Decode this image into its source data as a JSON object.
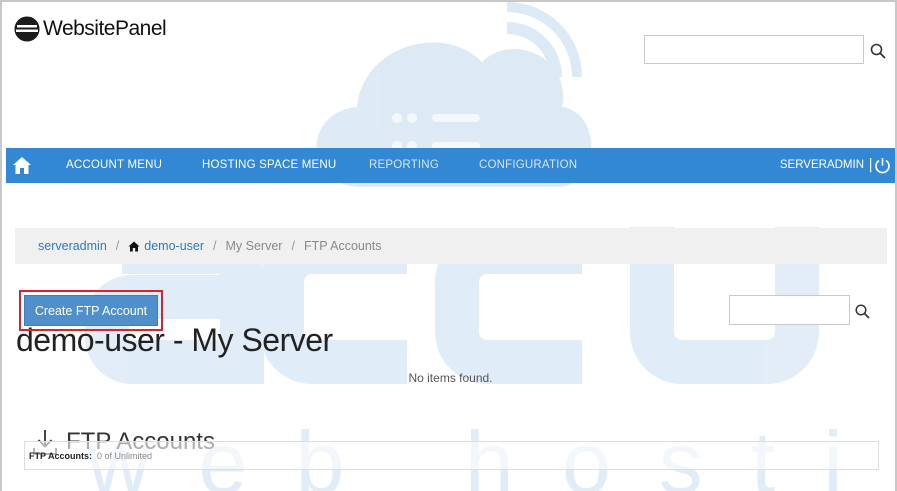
{
  "app": {
    "logo_text": "WebsitePanel"
  },
  "header": {
    "search_placeholder": ""
  },
  "nav": {
    "items": [
      {
        "label": "ACCOUNT MENU"
      },
      {
        "label": "HOSTING SPACE MENU"
      },
      {
        "label": "REPORTING"
      },
      {
        "label": "CONFIGURATION"
      }
    ],
    "user": "SERVERADMIN",
    "separator": "|"
  },
  "breadcrumb": {
    "items": [
      "serveradmin",
      "demo-user",
      "My Server",
      "FTP Accounts"
    ],
    "separator": "/"
  },
  "page": {
    "title": "demo-user - My Server"
  },
  "section": {
    "title": "FTP Accounts"
  },
  "toolbar": {
    "create_label": "Create FTP Account",
    "search_placeholder": ""
  },
  "grid": {
    "empty_text": "No items found."
  },
  "quota": {
    "label": "FTP Accounts:",
    "value": "0 of Unlimited"
  },
  "watermark": {
    "brand": "accu",
    "tagline": "web hosting"
  },
  "colors": {
    "nav": "#3288d4",
    "link": "#2a7bc0",
    "button": "#4f8fcc",
    "highlight": "#d9232a",
    "watermark": "#2f80c8"
  },
  "icons": [
    "home-icon",
    "search-icon",
    "power-icon",
    "download-icon",
    "cloud-icon"
  ]
}
